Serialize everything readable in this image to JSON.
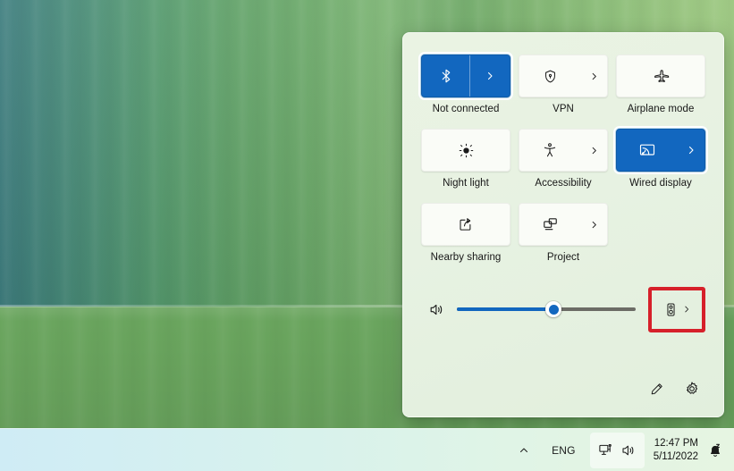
{
  "desktop": {
    "wallpaper_name": "windows-11-green-bloom-wallpaper",
    "colors": {
      "top_left": "#3d7d7e",
      "top_right": "#9ac77d",
      "mid_left": "#6fa9ad",
      "mid_right": "#aed49f",
      "taskbar_left": "#cfecf5",
      "taskbar_right": "#e6f5e2"
    }
  },
  "quick_settings": {
    "panel_name": "Quick Settings",
    "accent_color": "#1267bf",
    "tile_color": "#fafcf7",
    "panel_background": "#e7f2e2",
    "tiles": [
      {
        "label": "Not connected",
        "icon": "bluetooth-icon",
        "active": true,
        "has_chevron": true,
        "split": true,
        "focused": true
      },
      {
        "label": "VPN",
        "icon": "shield-lock-icon",
        "active": false,
        "has_chevron": true,
        "split": false,
        "focused": false
      },
      {
        "label": "Airplane mode",
        "icon": "airplane-icon",
        "active": false,
        "has_chevron": false,
        "split": false,
        "focused": false
      },
      {
        "label": "Night light",
        "icon": "night-light-icon",
        "active": false,
        "has_chevron": false,
        "split": false,
        "focused": false
      },
      {
        "label": "Accessibility",
        "icon": "accessibility-icon",
        "active": false,
        "has_chevron": true,
        "split": false,
        "focused": false
      },
      {
        "label": "Wired display",
        "icon": "cast-display-icon",
        "active": true,
        "has_chevron": true,
        "split": false,
        "focused": true
      },
      {
        "label": "Nearby sharing",
        "icon": "nearby-share-icon",
        "active": false,
        "has_chevron": false,
        "split": false,
        "focused": false
      },
      {
        "label": "Project",
        "icon": "project-screen-icon",
        "active": false,
        "has_chevron": true,
        "split": false,
        "focused": false
      }
    ],
    "volume": {
      "icon": "volume-speaker-icon",
      "value_percent": 54,
      "output_selector_icon": "audio-output-device-icon",
      "output_selector_chevron": "chevron-right-icon",
      "highlight_color": "#d6202a"
    },
    "footer": {
      "edit_icon": "pencil-edit-icon",
      "settings_icon": "gear-settings-icon"
    }
  },
  "taskbar": {
    "chevron_icon": "chevron-up-icon",
    "language": "ENG",
    "tray_icons": [
      {
        "name": "network-monitor-icon"
      },
      {
        "name": "volume-speaker-icon"
      }
    ],
    "clock": {
      "time": "12:47 PM",
      "date": "5/11/2022"
    },
    "notification_icon": "bell-do-not-disturb-icon"
  }
}
